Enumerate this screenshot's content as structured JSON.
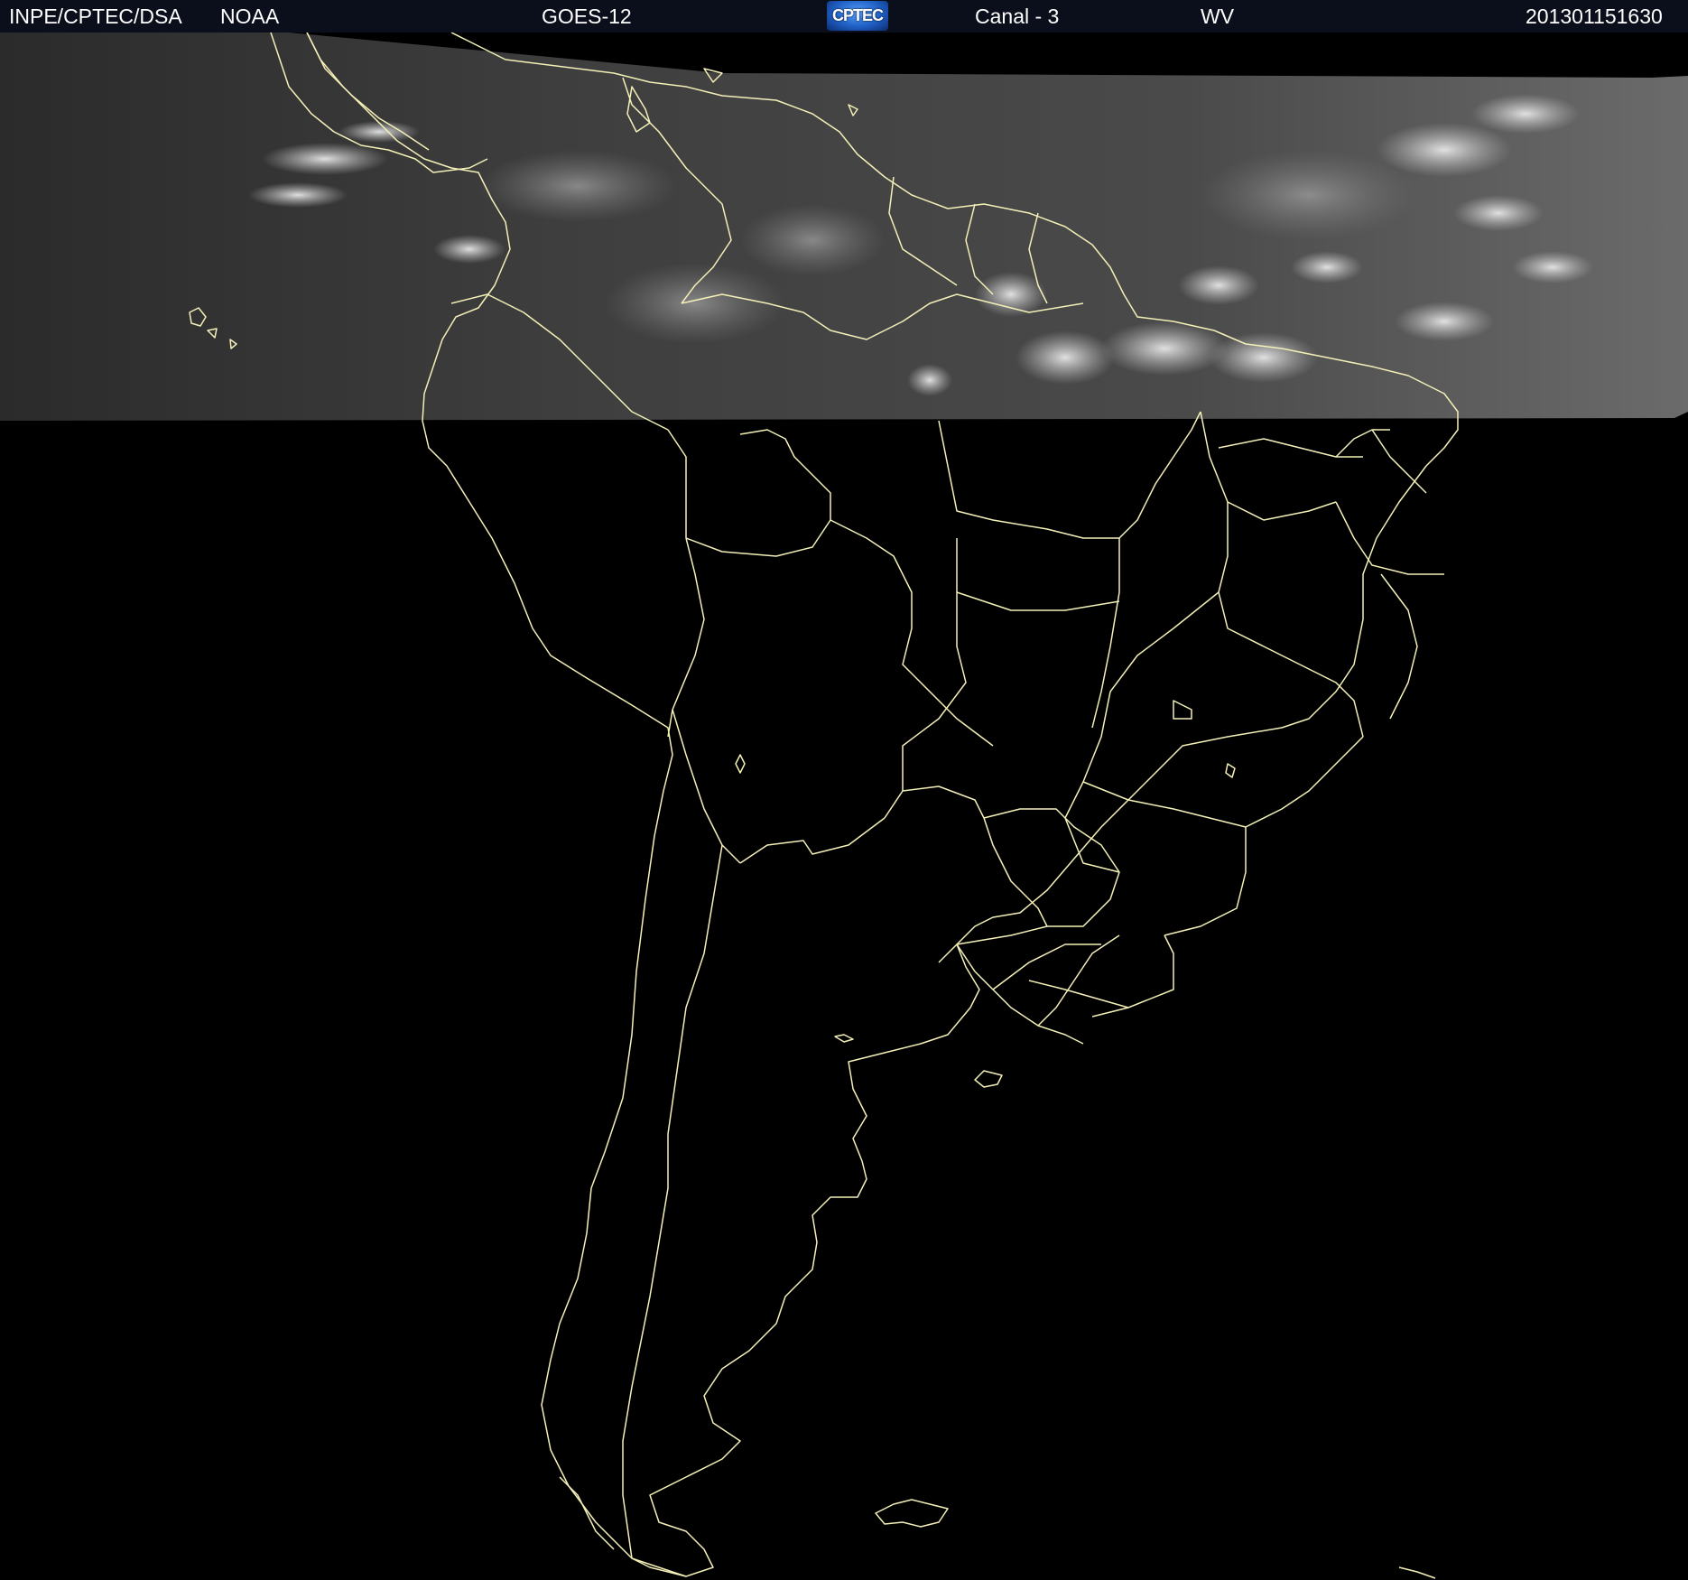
{
  "header": {
    "institution": "INPE/CPTEC/DSA",
    "agency": "NOAA",
    "satellite": "GOES-12",
    "logo_text": "CPTEC",
    "channel": "Canal - 3",
    "band": "WV",
    "timestamp": "201301151630"
  },
  "colors": {
    "background": "#000000",
    "coastline": "#f4f0b8",
    "header_bg": "#0b0f1c",
    "header_text": "#ffffff",
    "logo": "#2a6fd6"
  },
  "icons": {
    "logo": "cptec-logo-icon"
  }
}
